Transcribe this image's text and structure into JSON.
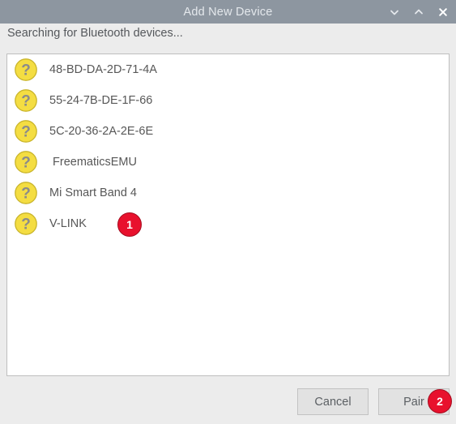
{
  "window": {
    "title": "Add New Device",
    "controls": [
      {
        "name": "minimize-icon",
        "glyph": "chevron-down"
      },
      {
        "name": "maximize-icon",
        "glyph": "chevron-up"
      },
      {
        "name": "close-icon",
        "glyph": "cross"
      }
    ]
  },
  "status": {
    "text": "Searching for Bluetooth devices..."
  },
  "device_list": {
    "icon_name": "unknown-device-icon",
    "devices": [
      {
        "label": "48-BD-DA-2D-71-4A"
      },
      {
        "label": "55-24-7B-DE-1F-66"
      },
      {
        "label": "5C-20-36-2A-2E-6E"
      },
      {
        "label": " FreematicsEMU"
      },
      {
        "label": "Mi Smart Band 4"
      },
      {
        "label": "V-LINK"
      }
    ]
  },
  "buttons": {
    "cancel_label": "Cancel",
    "pair_label": "Pair"
  },
  "markers": [
    {
      "label": "1"
    },
    {
      "label": "2"
    }
  ],
  "colors": {
    "titlebar": "#8d96a0",
    "dialog_background": "#ececec",
    "list_background": "#ffffff",
    "device_icon": "#f2d83b",
    "marker": "#e8112d",
    "text": "#575757"
  }
}
